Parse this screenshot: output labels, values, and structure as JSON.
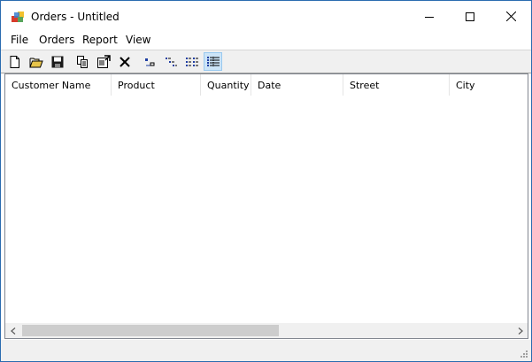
{
  "window": {
    "title": "Orders - Untitled",
    "accent_color": "#2b6cb0"
  },
  "menu": {
    "items": [
      {
        "label": "File"
      },
      {
        "label": "Orders"
      },
      {
        "label": "Report"
      },
      {
        "label": "View"
      }
    ]
  },
  "toolbar": {
    "buttons": [
      {
        "icon": "new-document-icon"
      },
      {
        "icon": "open-folder-icon"
      },
      {
        "icon": "save-icon"
      },
      {
        "icon": "copy-icon"
      },
      {
        "icon": "properties-icon"
      },
      {
        "icon": "delete-icon"
      },
      {
        "icon": "view-large-icons-icon"
      },
      {
        "icon": "view-small-icons-icon"
      },
      {
        "icon": "view-list-icon"
      },
      {
        "icon": "view-details-icon",
        "active": true
      }
    ]
  },
  "listview": {
    "columns": [
      {
        "label": "Customer Name"
      },
      {
        "label": "Product"
      },
      {
        "label": "Quantity"
      },
      {
        "label": "Date"
      },
      {
        "label": "Street"
      },
      {
        "label": "City"
      }
    ],
    "rows": []
  }
}
